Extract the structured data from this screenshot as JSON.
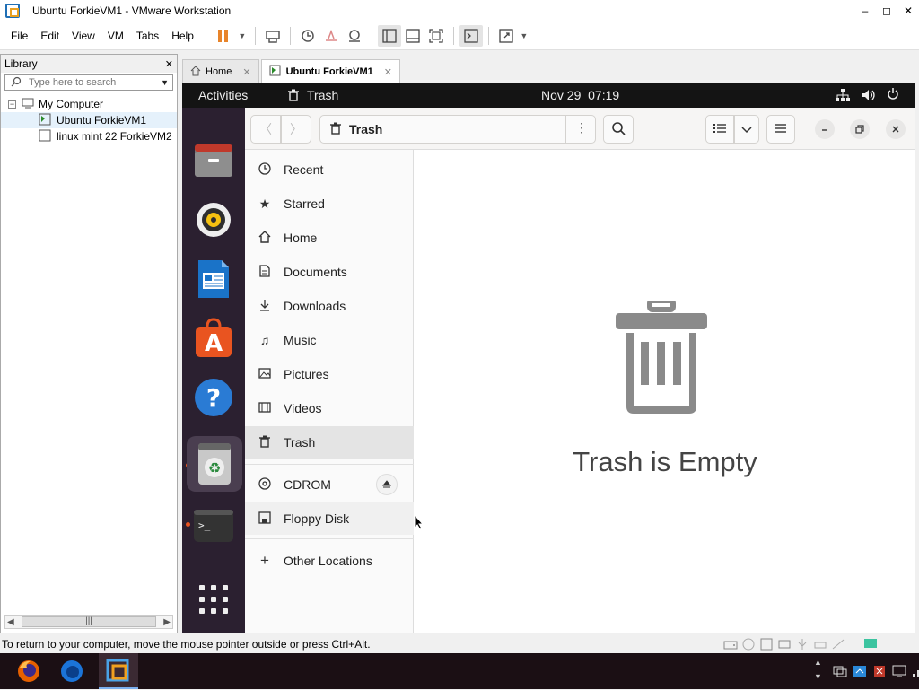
{
  "window": {
    "title": "Ubuntu ForkieVM1 - VMware Workstation",
    "minimize": "–",
    "maximize": "◻",
    "close": "✕"
  },
  "menu": [
    "File",
    "Edit",
    "View",
    "VM",
    "Tabs",
    "Help"
  ],
  "library": {
    "title": "Library",
    "close": "✕",
    "search_placeholder": "Type here to search",
    "tree": {
      "root": "My Computer",
      "vms": [
        "Ubuntu ForkieVM1",
        "linux mint 22 ForkieVM2"
      ]
    }
  },
  "tabs": [
    {
      "label": "Home"
    },
    {
      "label": "Ubuntu ForkieVM1"
    }
  ],
  "guest": {
    "activities": "Activities",
    "app_name": "Trash",
    "clock": "Nov 29  07:19"
  },
  "files": {
    "path": "Trash",
    "sidebar": [
      {
        "label": "Recent",
        "icon": "clock-icon"
      },
      {
        "label": "Starred",
        "icon": "star-icon"
      },
      {
        "label": "Home",
        "icon": "home-icon"
      },
      {
        "label": "Documents",
        "icon": "document-icon"
      },
      {
        "label": "Downloads",
        "icon": "download-icon"
      },
      {
        "label": "Music",
        "icon": "music-icon"
      },
      {
        "label": "Pictures",
        "icon": "picture-icon"
      },
      {
        "label": "Videos",
        "icon": "video-icon"
      },
      {
        "label": "Trash",
        "icon": "trash-icon"
      }
    ],
    "devices": [
      {
        "label": "CDROM"
      },
      {
        "label": "Floppy Disk"
      }
    ],
    "other": "Other Locations",
    "empty_message": "Trash is Empty"
  },
  "statusbar": {
    "message": "To return to your computer, move the mouse pointer outside or press Ctrl+Alt."
  },
  "colors": {
    "ubuntu_orange": "#e95420",
    "dock_bg": "#2b2030",
    "topbar_bg": "#141414"
  }
}
